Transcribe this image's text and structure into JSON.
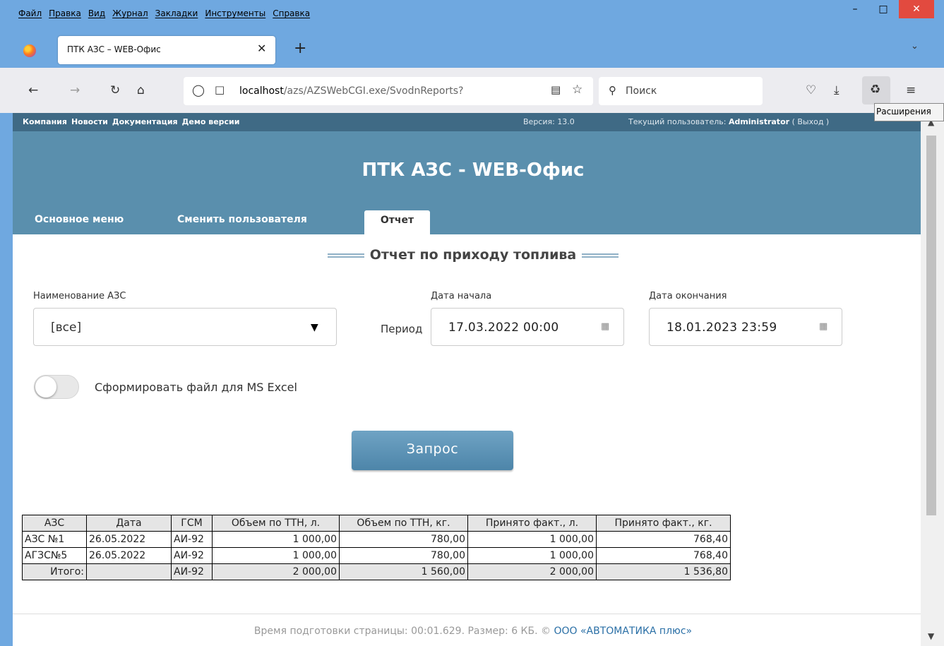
{
  "browser": {
    "menu": [
      "Файл",
      "Правка",
      "Вид",
      "Журнал",
      "Закладки",
      "Инструменты",
      "Справка"
    ],
    "tab_title": "ПТК АЗС – WEB-Офис",
    "url_host": "localhost",
    "url_path": "/azs/AZSWebCGI.exe/SvodnReports?",
    "search_placeholder": "Поиск",
    "tooltip": "Расширения"
  },
  "site": {
    "links": [
      "Компания",
      "Новости",
      "Документация",
      "Демо версии"
    ],
    "version": "Версия: 13.0",
    "user_prefix": "Текущий пользователь:",
    "user_name": "Administrator",
    "logout": "( Выход )",
    "title": "ПТК АЗС - WEB-Офис",
    "nav": [
      "Основное меню",
      "Сменить пользователя",
      "Отчет"
    ]
  },
  "form": {
    "report_title": "Отчет по приходу топлива",
    "station_label": "Наименование АЗС",
    "station_value": "[все]",
    "period_label": "Период",
    "start_label": "Дата начала",
    "start_value": "17.03.2022  00:00",
    "end_label": "Дата окончания",
    "end_value": "18.01.2023  23:59",
    "excel_label": "Сформировать файл для MS Excel",
    "excel_enabled": false,
    "submit": "Запрос"
  },
  "table": {
    "columns": [
      "АЗС",
      "Дата",
      "ГСМ",
      "Объем по ТТН, л.",
      "Объем по ТТН, кг.",
      "Принято факт., л.",
      "Принято факт., кг."
    ],
    "rows": [
      [
        "АЗС №1",
        "26.05.2022",
        "АИ-92",
        "1 000,00",
        "780,00",
        "1 000,00",
        "768,40"
      ],
      [
        "АГЗС№5",
        "26.05.2022",
        "АИ-92",
        "1 000,00",
        "780,00",
        "1 000,00",
        "768,40"
      ]
    ],
    "total": [
      "Итого:",
      "",
      "АИ-92",
      "2 000,00",
      "1 560,00",
      "2 000,00",
      "1 536,80"
    ]
  },
  "footer": {
    "text": "Время подготовки страницы: 00:01.629. Размер: 6 КБ. ©",
    "company": "ООО «АВТОМАТИКА плюс»"
  }
}
